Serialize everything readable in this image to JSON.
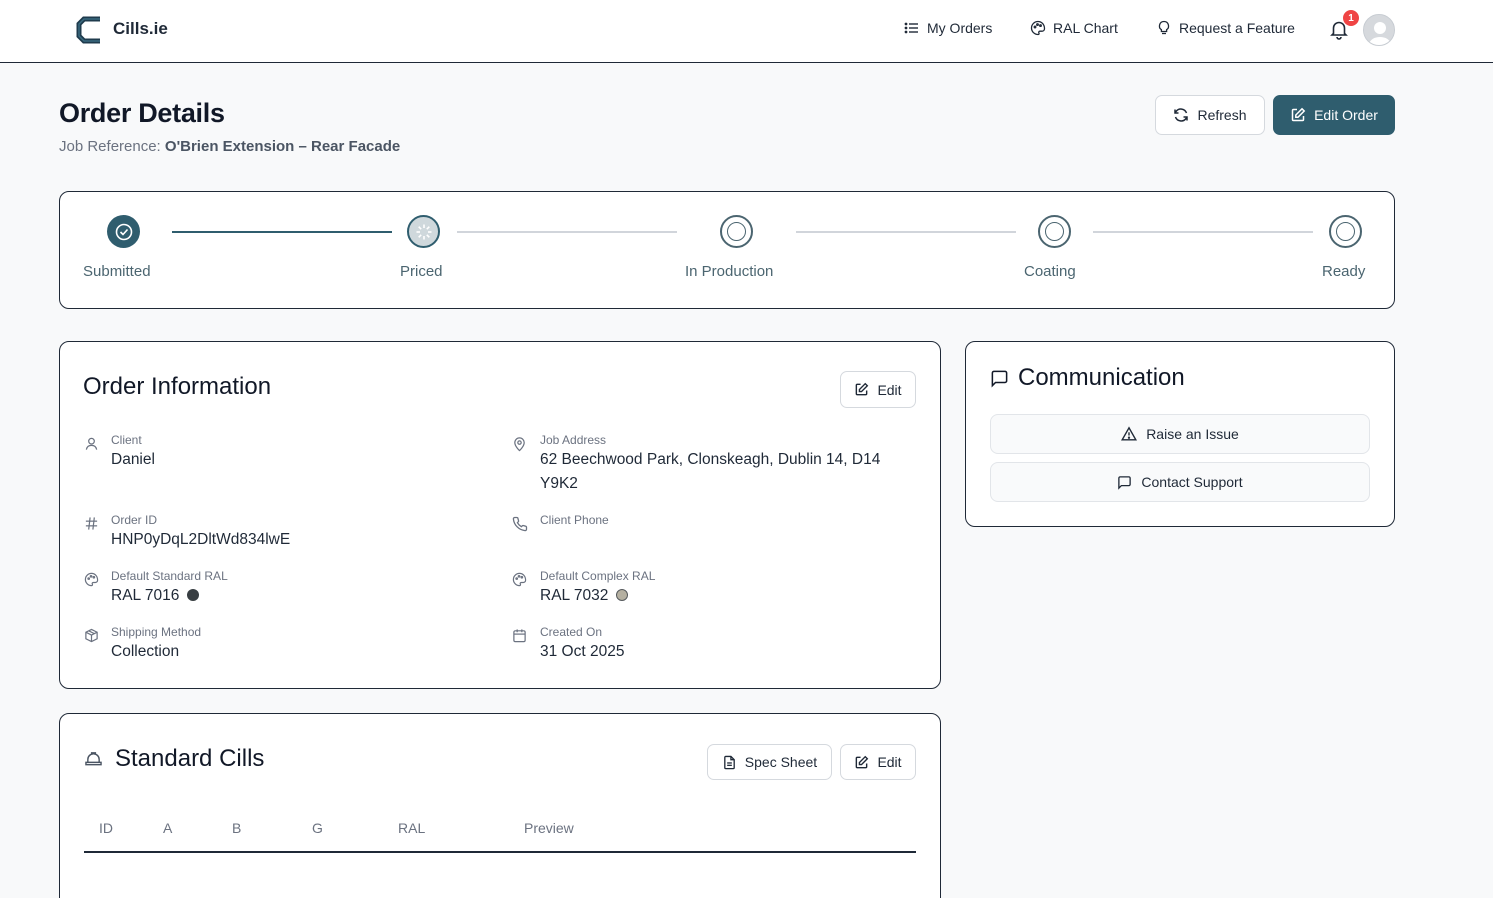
{
  "header": {
    "brand": "Cills.ie",
    "nav": [
      {
        "label": "My Orders",
        "icon": "list-icon"
      },
      {
        "label": "RAL Chart",
        "icon": "palette-icon"
      },
      {
        "label": "Request a Feature",
        "icon": "lightbulb-icon"
      }
    ],
    "notification_count": "1"
  },
  "page": {
    "title": "Order Details",
    "job_reference_label": "Job Reference:",
    "job_reference_value": "O'Brien Extension – Rear Facade",
    "refresh_label": "Refresh",
    "edit_order_label": "Edit Order"
  },
  "progress": {
    "steps": [
      {
        "label": "Submitted",
        "state": "done"
      },
      {
        "label": "Priced",
        "state": "current"
      },
      {
        "label": "In Production",
        "state": "pending"
      },
      {
        "label": "Coating",
        "state": "pending"
      },
      {
        "label": "Ready",
        "state": "pending"
      }
    ]
  },
  "order_info": {
    "title": "Order Information",
    "edit_label": "Edit",
    "fields": {
      "client": {
        "label": "Client",
        "value": "Daniel"
      },
      "job_address": {
        "label": "Job Address",
        "value": "62 Beechwood Park, Clonskeagh, Dublin 14, D14 Y9K2"
      },
      "order_id": {
        "label": "Order ID",
        "value": "HNP0yDqL2DltWd834lwE"
      },
      "client_phone": {
        "label": "Client Phone",
        "value": ""
      },
      "default_standard_ral": {
        "label": "Default Standard RAL",
        "value": "RAL 7016",
        "swatch": "#383e42"
      },
      "default_complex_ral": {
        "label": "Default Complex RAL",
        "value": "RAL 7032",
        "swatch": "#b5b0a1"
      },
      "shipping_method": {
        "label": "Shipping Method",
        "value": "Collection"
      },
      "created_on": {
        "label": "Created On",
        "value": "31 Oct 2025"
      }
    }
  },
  "communication": {
    "title": "Communication",
    "raise_issue_label": "Raise an Issue",
    "contact_support_label": "Contact Support"
  },
  "standard_cills": {
    "title": "Standard Cills",
    "spec_sheet_label": "Spec Sheet",
    "edit_label": "Edit",
    "columns": [
      "ID",
      "A",
      "B",
      "G",
      "RAL",
      "Preview"
    ]
  },
  "colors": {
    "primary": "#2f5d6e",
    "badge": "#ef4444"
  }
}
